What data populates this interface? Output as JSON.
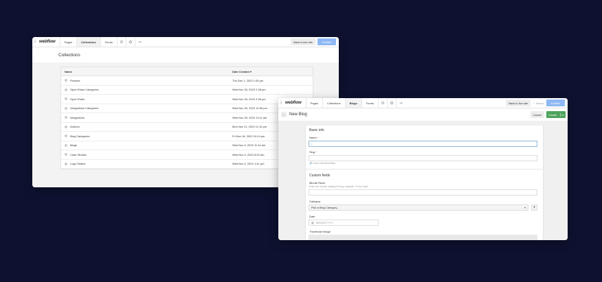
{
  "colors": {
    "background": "#0e1230",
    "publish": "#8fb8f5",
    "create": "#4ea35c"
  },
  "window1": {
    "logo": "webflow",
    "nav": [
      "Pages",
      "Collections",
      "Forms"
    ],
    "active_nav": "Collections",
    "icons": [
      "gear-icon",
      "settings-icon",
      "logout-icon"
    ],
    "back_label": "Back to live site",
    "publish_label": "Publish",
    "page_title": "Collections",
    "table": {
      "col_name": "Name",
      "col_date": "Date Created",
      "sort_indicator": "▾",
      "rows": [
        {
          "name": "Presses",
          "date": "Thu Dec 1, 2022 1:05 pm"
        },
        {
          "name": "Open Roles Categories",
          "date": "Wed Nov 30, 2022 2:38 pm"
        },
        {
          "name": "Open Roles",
          "date": "Wed Nov 30, 2022 2:36 pm"
        },
        {
          "name": "Integrations Categories",
          "date": "Wed Nov 30, 2022 12:06 pm"
        },
        {
          "name": "Integrations",
          "date": "Wed Nov 30, 2022 11:11 am"
        },
        {
          "name": "Authors",
          "date": "Mon Nov 21, 2022 11:15 pm"
        },
        {
          "name": "Blog Categories",
          "date": "Fri Nov 18, 2022 10:14 pm"
        },
        {
          "name": "Blogs",
          "date": "Wed Nov 9, 2022 11:14 am"
        },
        {
          "name": "Case Studies",
          "date": "Wed Nov 9, 2022 8:20 am"
        },
        {
          "name": "Logo Sliders",
          "date": "Wed Nov 2, 2022 1:41 pm"
        }
      ]
    }
  },
  "window2": {
    "logo": "webflow",
    "nav": [
      "Pages",
      "Collections",
      "Blogs",
      "Forms"
    ],
    "active_nav": "Blogs",
    "back_label": "Back to live site",
    "saved_label": "✓ Saved",
    "publish_label": "Publish",
    "title": "New Blog",
    "cancel_label": "Cancel",
    "create_label": "Create",
    "basic_info": "Basic info",
    "name_label": "Name",
    "name_value": "|",
    "slug_label": "Slug",
    "slug_hint": "🔗 Leave this field blank",
    "custom_fields": "Custom fields",
    "minute_read_label": "Minute Read",
    "minute_read_hint": "Enter the minute reading of blog, example: \"5 min read\"",
    "category_label": "Category",
    "category_placeholder": "Pick a Blog Category...",
    "date_label": "Date",
    "date_placeholder": "MM/DD/YYYY",
    "thumbnail_label": "Thumbnail Image"
  }
}
